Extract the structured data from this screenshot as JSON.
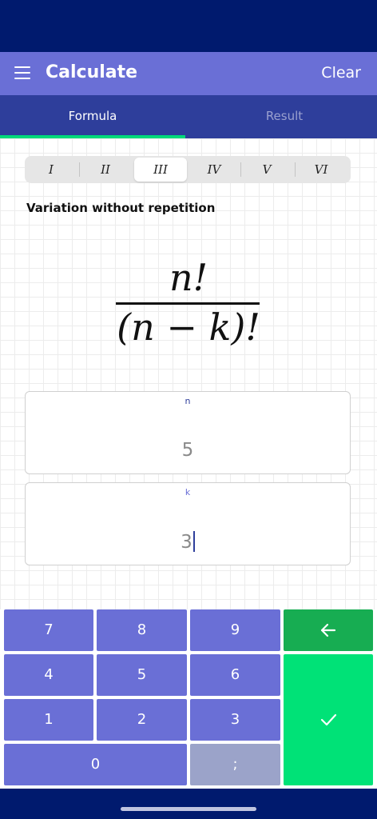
{
  "app": {
    "title": "Calculate",
    "clear_label": "Clear"
  },
  "tabs": [
    {
      "label": "Formula",
      "active": true
    },
    {
      "label": "Result",
      "active": false
    }
  ],
  "variants": {
    "items": [
      "I",
      "II",
      "III",
      "IV",
      "V",
      "VI"
    ],
    "selected": "III"
  },
  "formula": {
    "name": "Variation without repetition",
    "numerator": "n!",
    "denominator": "(n − k)!"
  },
  "fields": {
    "n": {
      "label": "n",
      "value": "5"
    },
    "k": {
      "label": "k",
      "value": "3"
    }
  },
  "keypad": {
    "keys": [
      "7",
      "8",
      "9",
      "4",
      "5",
      "6",
      "1",
      "2",
      "3",
      "0",
      ";"
    ],
    "backspace_icon": "arrow-left-icon",
    "confirm_icon": "check-icon"
  },
  "colors": {
    "status_bar": "#001a6e",
    "app_bar": "#6a6fd6",
    "tabs_bg": "#2e3e9b",
    "accent": "#00d97a",
    "key": "#6a6fd6",
    "backspace": "#17ad52",
    "confirm": "#00e277"
  }
}
